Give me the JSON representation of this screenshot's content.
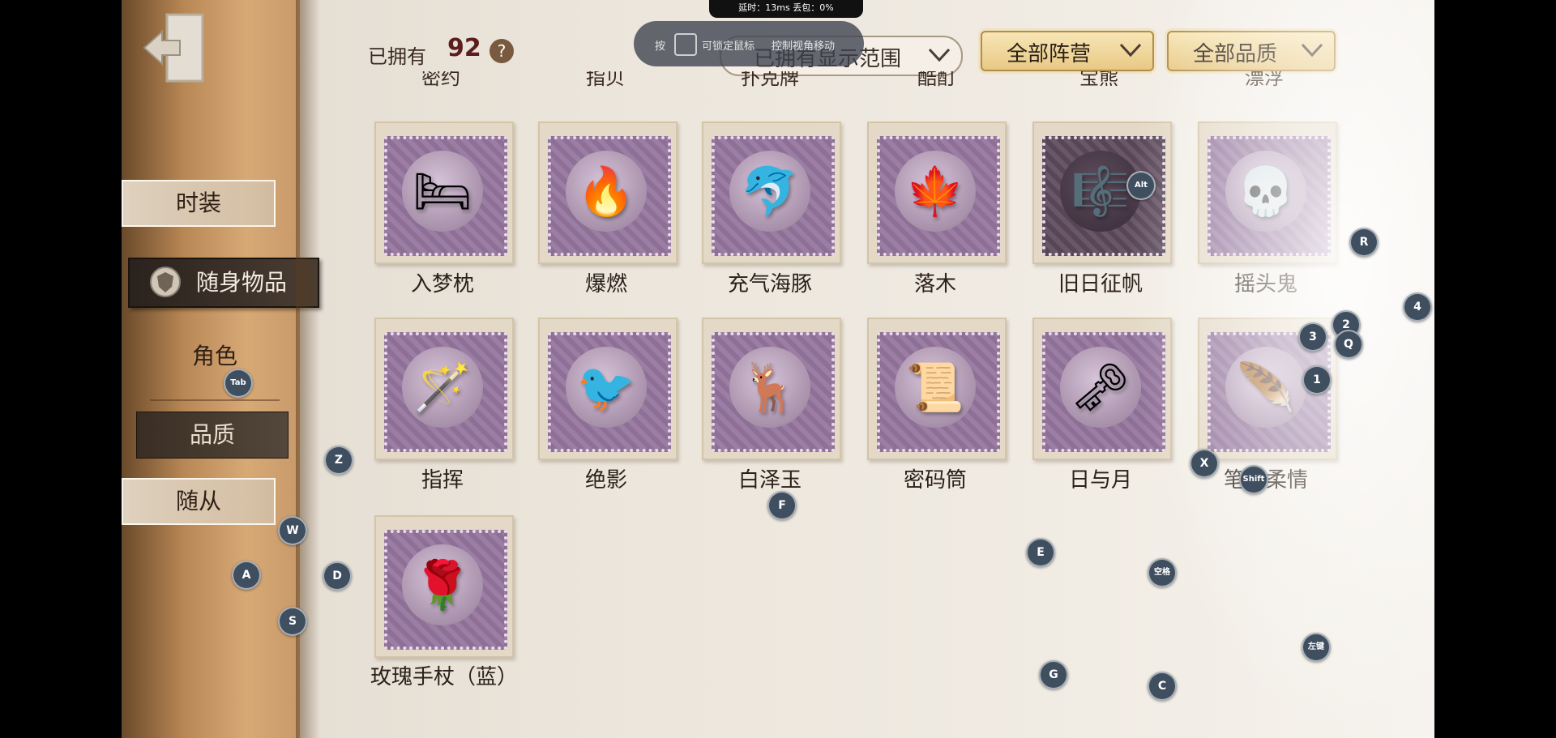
{
  "sidebar": {
    "tabs": [
      {
        "label": "时装",
        "active": false
      },
      {
        "label": "随身物品",
        "active": true
      },
      {
        "label": "角色",
        "active": false
      },
      {
        "label": "品质",
        "active": false
      },
      {
        "label": "随从",
        "active": false
      }
    ]
  },
  "header": {
    "owned_label": "已拥有",
    "owned_count": "92",
    "help_symbol": "?",
    "filter_range": "已拥有显示范围",
    "filter_camp": "全部阵营",
    "filter_quality": "全部品质"
  },
  "partial_row": [
    "密约",
    "指贝",
    "扑克牌",
    "酷酊",
    "宝熊",
    "漂浮"
  ],
  "items": [
    {
      "name": "入梦枕",
      "icon": "pillow-icon",
      "glyph": "🛏"
    },
    {
      "name": "爆燃",
      "icon": "torch-icon",
      "glyph": "🔥"
    },
    {
      "name": "充气海豚",
      "icon": "dolphin-icon",
      "glyph": "🐬"
    },
    {
      "name": "落木",
      "icon": "leaves-frame-icon",
      "glyph": "🍁"
    },
    {
      "name": "旧日征帆",
      "icon": "music-note-icon",
      "glyph": "🎼"
    },
    {
      "name": "摇头鬼",
      "icon": "skull-rattle-icon",
      "glyph": "💀"
    },
    {
      "name": "指挥",
      "icon": "baton-icon",
      "glyph": "🪄"
    },
    {
      "name": "绝影",
      "icon": "crow-icon",
      "glyph": "🐦"
    },
    {
      "name": "白泽玉",
      "icon": "jade-deer-icon",
      "glyph": "🦌"
    },
    {
      "name": "密码筒",
      "icon": "cryptex-icon",
      "glyph": "📜"
    },
    {
      "name": "日与月",
      "icon": "sun-key-icon",
      "glyph": "🗝"
    },
    {
      "name": "笔下柔情",
      "icon": "quill-icon",
      "glyph": "🪶"
    },
    {
      "name": "玫瑰手杖（蓝）",
      "icon": "blue-rose-cane-icon",
      "glyph": "🌹"
    }
  ],
  "overlay": {
    "stats": "延时：13ms    丢包：0%",
    "hint_press": "按",
    "hint_lock": "可锁定鼠标",
    "hint_move": "控制视角移动"
  },
  "keys": [
    "R",
    "4",
    "2",
    "3",
    "Q",
    "1",
    "Alt",
    "Tab",
    "Z",
    "X",
    "Shift",
    "F",
    "W",
    "A",
    "D",
    "S",
    "E",
    "空格",
    "左键",
    "G",
    "C"
  ],
  "colors": {
    "accent_gold": "#e8c985",
    "stamp_purple": "#9c7ea4",
    "key_bubble": "#3f4f60"
  }
}
